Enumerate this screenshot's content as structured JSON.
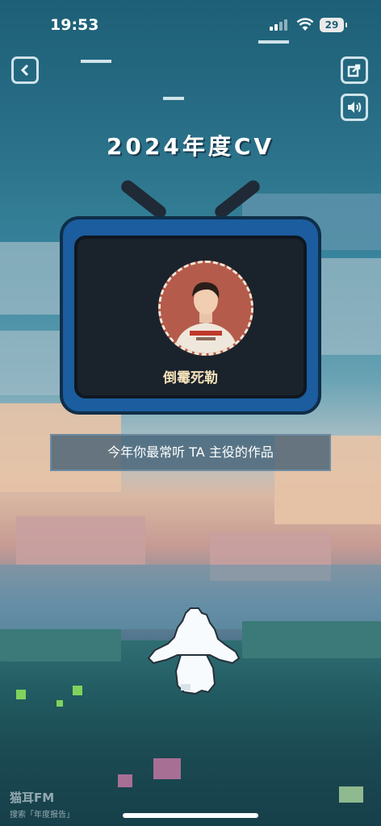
{
  "status_bar": {
    "time": "19:53",
    "battery": "29"
  },
  "header": {
    "title": "2024年度CV"
  },
  "icons": {
    "back": "chevron-left-icon",
    "share": "share-icon",
    "sound": "speaker-icon"
  },
  "tv": {
    "cv_name": "倒霉死勒"
  },
  "banner": {
    "text": "今年你最常听 TA 主役的作品"
  },
  "watermark": {
    "logo": "猫耳FM",
    "sub": "搜索「年度报告」"
  },
  "colors": {
    "tv_frame": "#1b5d9e",
    "screen": "#1a222c",
    "name_text": "#f2e0b8"
  }
}
